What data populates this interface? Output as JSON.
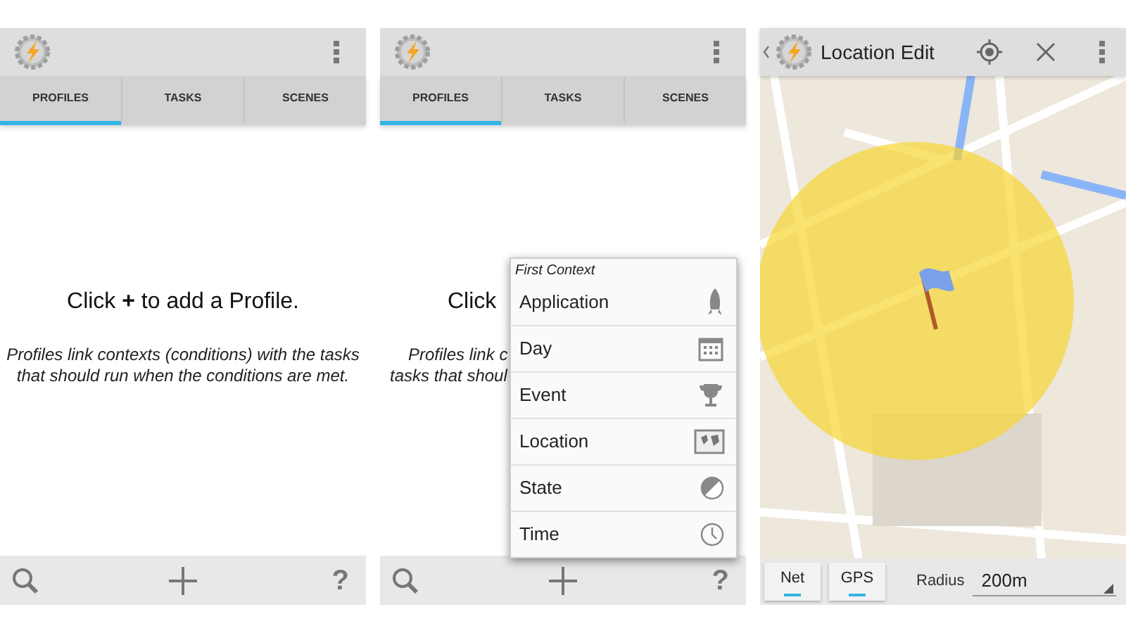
{
  "screens": [
    {
      "kind": "profiles",
      "tabs": [
        {
          "label": "PROFILES",
          "selected": true
        },
        {
          "label": "TASKS",
          "selected": false
        },
        {
          "label": "SCENES",
          "selected": false
        }
      ],
      "empty_lines": [
        {
          "text": "Click **+** to add a Profile.",
          "kind": "title"
        },
        {
          "text": "Profiles link contexts (conditions) with the tasks that should run when the conditions are met.",
          "kind": "hint"
        }
      ],
      "help_label": "?"
    },
    {
      "kind": "profiles",
      "tabs": [
        {
          "label": "PROFILES",
          "selected": true
        },
        {
          "label": "TASKS",
          "selected": false
        },
        {
          "label": "SCENES",
          "selected": false
        }
      ],
      "empty_lines": [
        {
          "text": "Click",
          "kind": "title"
        },
        {
          "text": "Profiles link c",
          "kind": "hint"
        },
        {
          "text": "tasks that shoul",
          "kind": "hint"
        }
      ],
      "help_label": "?",
      "menu": {
        "title": "First Context",
        "items": [
          {
            "label": "Application"
          },
          {
            "label": "Day"
          },
          {
            "label": "Event"
          },
          {
            "label": "Location"
          },
          {
            "label": "State"
          },
          {
            "label": "Time"
          }
        ]
      }
    },
    {
      "kind": "location",
      "title": "Location Edit",
      "modes": [
        {
          "label": "Net",
          "on": true
        },
        {
          "label": "GPS",
          "on": true
        }
      ],
      "radius_label": "Radius",
      "radius_value": "200m"
    }
  ]
}
